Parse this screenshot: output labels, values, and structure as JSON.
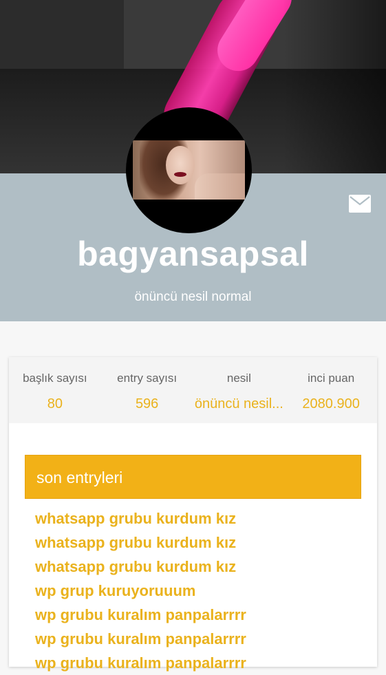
{
  "profile": {
    "username": "bagyansapsal",
    "title": "önüncü nesil normal"
  },
  "stats": [
    {
      "label": "başlık sayısı",
      "value": "80"
    },
    {
      "label": "entry sayısı",
      "value": "596"
    },
    {
      "label": "nesil",
      "value": "önüncü nesil..."
    },
    {
      "label": "inci puan",
      "value": "2080.900"
    }
  ],
  "recent": {
    "header": "son entryleri",
    "entries": [
      "whatsapp grubu kurdum kız",
      "whatsapp grubu kurdum kız",
      "whatsapp grubu kurdum kız",
      "wp grup kuruyoruuum",
      "wp grubu kuralım panpalarrrr",
      "wp grubu kuralım panpalarrrr",
      "wp grubu kuralım panpalarrrr"
    ]
  },
  "icons": {
    "message": "mail-icon"
  },
  "colors": {
    "accent": "#f2b117",
    "accent_text": "#eab21d",
    "profile_band": "#b0bec5",
    "stats_bg": "#f4f4f4"
  }
}
